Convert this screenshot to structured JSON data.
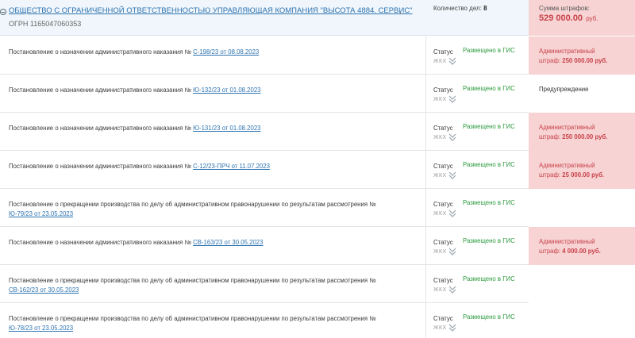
{
  "header": {
    "org_name": "ОБЩЕСТВО С ОГРАНИЧЕННОЙ ОТВЕТСТВЕННОСТЬЮ УПРАВЛЯЮЩАЯ КОМПАНИЯ \"ВЫСОТА 4884. СЕРВИС\"",
    "org_name_suffix": ",",
    "ogrn": "ОГРН 1165047060353",
    "cases_label": "Количество дел:",
    "cases_count": "8",
    "fines_label": "Сумма штрафов:",
    "fines_total": "529 000.00",
    "fines_currency": "руб."
  },
  "rows": [
    {
      "desc": "Постановление о назначении административного наказания №",
      "link": "С-198/23 от 08.08.2023",
      "status_label": "Статус",
      "status": "Размещено в ГИС",
      "status_sub": "ЖКХ",
      "fine_type": "Административный",
      "fine_prefix": "штраф: ",
      "fine_amount": "250 000.00 руб."
    },
    {
      "desc": "Постановление о назначении административного наказания №",
      "link": "Ю-132/23 от 01.08.2023",
      "status_label": "Статус",
      "status": "Размещено в ГИС",
      "status_sub": "ЖКХ",
      "fine_type": "Предупреждение",
      "fine_prefix": "",
      "fine_amount": ""
    },
    {
      "desc": "Постановление о назначении административного наказания №",
      "link": "Ю-131/23 от 01.08.2023",
      "status_label": "Статус",
      "status": "Размещено в ГИС",
      "status_sub": "ЖКХ",
      "fine_type": "Административный",
      "fine_prefix": "штраф: ",
      "fine_amount": "250 000.00 руб."
    },
    {
      "desc": "Постановление о назначении административного наказания №",
      "link": "С-12/23-ПРЧ от 11.07.2023",
      "status_label": "Статус",
      "status": "Размещено в ГИС",
      "status_sub": "ЖКХ",
      "fine_type": "Административный",
      "fine_prefix": "штраф: ",
      "fine_amount": "25 000.00 руб."
    },
    {
      "desc": "Постановление о прекращении производства по делу об административном правонарушении по результатам рассмотрения №",
      "link": "Ю-79/23 от 23.05.2023",
      "status_label": "Статус",
      "status": "Размещено в ГИС",
      "status_sub": "ЖКХ",
      "fine_type": "",
      "fine_prefix": "",
      "fine_amount": ""
    },
    {
      "desc": "Постановление о назначении административного наказания №",
      "link": "СВ-163/23 от 30.05.2023",
      "status_label": "Статус",
      "status": "Размещено в ГИС",
      "status_sub": "ЖКХ",
      "fine_type": "Административный",
      "fine_prefix": "штраф: ",
      "fine_amount": "4 000.00 руб."
    },
    {
      "desc": "Постановление о прекращении производства по делу об административном правонарушении по результатам рассмотрения №",
      "link": "СВ-162/23 от 30.05.2023",
      "status_label": "Статус",
      "status": "Размещено в ГИС",
      "status_sub": "ЖКХ",
      "fine_type": "",
      "fine_prefix": "",
      "fine_amount": ""
    },
    {
      "desc": "Постановление о прекращении производства по делу об административном правонарушении по результатам рассмотрения №",
      "link": "Ю-78/23 от 23.05.2023",
      "status_label": "Статус",
      "status": "Размещено в ГИС",
      "status_sub": "ЖКХ",
      "fine_type": "",
      "fine_prefix": "",
      "fine_amount": ""
    }
  ],
  "colors": {
    "link": "#2d73b0",
    "status_green": "#2b9a3e",
    "fine_red": "#c8424a",
    "fine_bg": "#f7d3d3",
    "header_bg": "#f0f6fb"
  },
  "icons": {
    "collapse": "minus-circle-icon",
    "expand": "double-chevron-down-icon"
  }
}
